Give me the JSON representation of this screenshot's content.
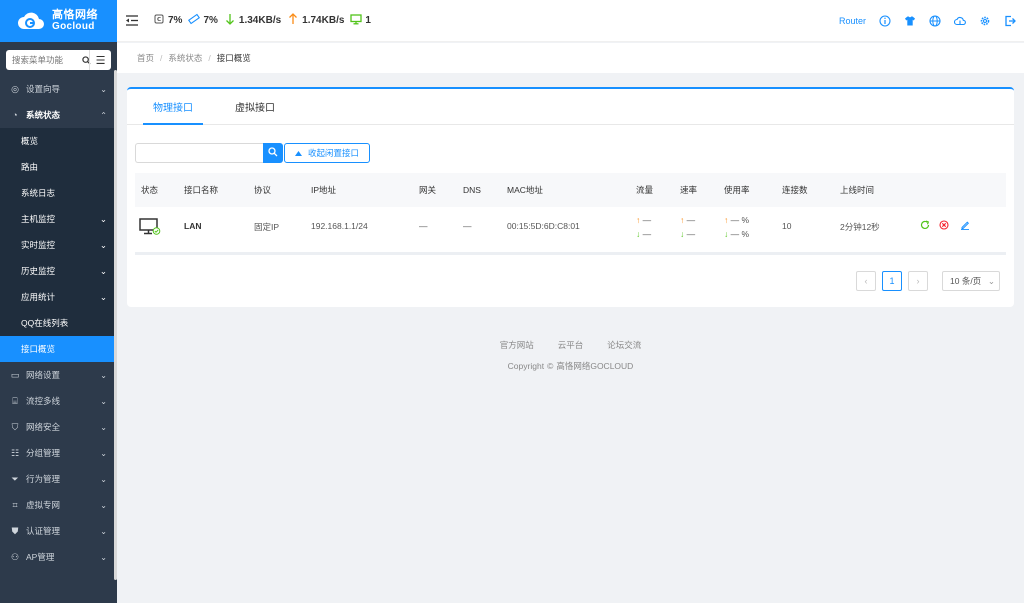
{
  "brand": {
    "name_cn": "高恪网络",
    "name_en": "Gocloud"
  },
  "sidebar": {
    "search_placeholder": "搜索菜单功能",
    "items": [
      {
        "label": "设置向导",
        "icon": "compass-icon"
      },
      {
        "label": "系统状态",
        "icon": "dashboard-icon",
        "open": true
      }
    ],
    "sub_items": [
      {
        "label": "概览"
      },
      {
        "label": "路由"
      },
      {
        "label": "系统日志"
      },
      {
        "label": "主机监控",
        "chev": true
      },
      {
        "label": "实时监控",
        "chev": true
      },
      {
        "label": "历史监控",
        "chev": true
      },
      {
        "label": "应用统计",
        "chev": true
      },
      {
        "label": "QQ在线列表"
      },
      {
        "label": "接口概览",
        "active": true
      }
    ],
    "items_after": [
      {
        "label": "网络设置",
        "icon": "monitor-icon"
      },
      {
        "label": "流控多线",
        "icon": "network-icon"
      },
      {
        "label": "网络安全",
        "icon": "shield-icon"
      },
      {
        "label": "分组管理",
        "icon": "list-icon"
      },
      {
        "label": "行为管理",
        "icon": "filter-icon"
      },
      {
        "label": "虚拟专网",
        "icon": "vpn-icon"
      },
      {
        "label": "认证管理",
        "icon": "auth-icon"
      },
      {
        "label": "AP管理",
        "icon": "ap-icon"
      }
    ]
  },
  "header": {
    "cpu": "7%",
    "mem": "7%",
    "down_speed": "1.34KB/s",
    "up_speed": "1.74KB/s",
    "online": "1",
    "router_label": "Router"
  },
  "breadcrumb": {
    "home": "首页",
    "parent": "系统状态",
    "current": "接口概览"
  },
  "tabs": [
    {
      "label": "物理接口",
      "active": true
    },
    {
      "label": "虚拟接口"
    }
  ],
  "toolbar": {
    "collapse_label": "收起闲置接口"
  },
  "table": {
    "headers": [
      "状态",
      "接口名称",
      "协议",
      "IP地址",
      "网关",
      "DNS",
      "MAC地址",
      "流量",
      "速率",
      "使用率",
      "连接数",
      "上线时间"
    ],
    "rows": [
      {
        "name": "LAN",
        "protocol": "固定IP",
        "ip": "192.168.1.1/24",
        "gateway": "—",
        "dns": "—",
        "mac": "00:15:5D:6D:C8:01",
        "traffic_up": "—",
        "traffic_down": "—",
        "rate_up": "—",
        "rate_down": "—",
        "usage_up": "— %",
        "usage_down": "— %",
        "connections": "10",
        "uptime": "2分钟12秒"
      }
    ]
  },
  "pager": {
    "current": "1",
    "page_size": "10 条/页"
  },
  "footer": {
    "links": [
      "官方网站",
      "云平台",
      "论坛交流"
    ],
    "copyright": "Copyright",
    "company": "高恪网络GOCLOUD"
  },
  "colors": {
    "primary": "#1890ff",
    "sidebar_bg": "#2d3a4b",
    "up": "#fa8c16",
    "down": "#52c41a"
  }
}
